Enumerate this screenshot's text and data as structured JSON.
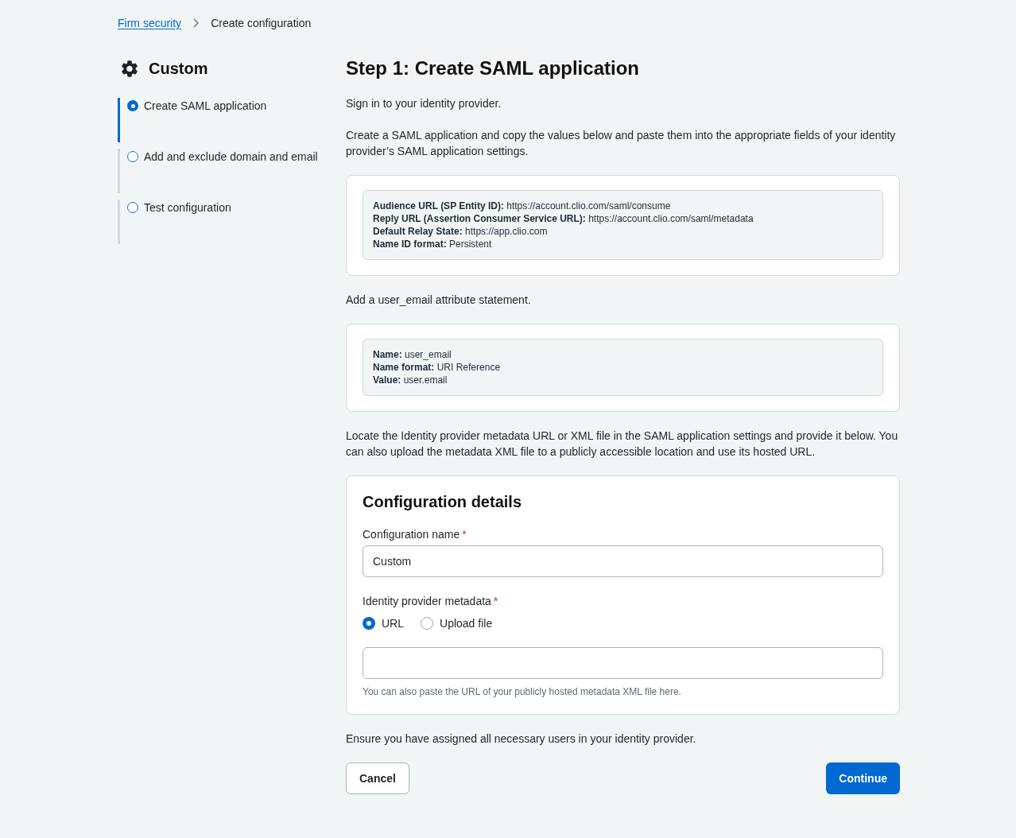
{
  "breadcrumb": [
    {
      "kind": "link",
      "label": "Firm security"
    },
    {
      "kind": "current",
      "label": "Create configuration"
    }
  ],
  "sidebar": {
    "title": "Custom",
    "steps": [
      {
        "label": "Create SAML application",
        "selected": true
      },
      {
        "label": "Add and exclude domain and email",
        "selected": false
      },
      {
        "label": "Test configuration",
        "selected": false
      }
    ]
  },
  "main": {
    "title": "Step 1: Create SAML application",
    "blocks": [
      {
        "kind": "paragraph",
        "text": "Sign in to your identity provider."
      },
      {
        "kind": "paragraph",
        "text": "Create a SAML application and copy the values below and paste them into the appropriate fields of your identity provider’s SAML application settings."
      },
      {
        "kind": "info_card",
        "lines": [
          "**Audience URL (SP Entity ID):** https://account.clio.com/saml/consume",
          "**Reply URL (Assertion Consumer Service URL):** https://account.clio.com/saml/metadata",
          "**Default Relay State:** https://app.clio.com",
          "**Name ID format:** Persistent"
        ]
      },
      {
        "kind": "paragraph",
        "text": "Add a user_email attribute statement."
      },
      {
        "kind": "info_card",
        "lines": [
          "**Name:** user_email",
          "**Name format:** URI Reference",
          "**Value:** user.email"
        ]
      },
      {
        "kind": "paragraph",
        "text": "Locate the Identity provider metadata URL or XML file in the SAML application settings and provide it below. You can also upload the metadata XML file to a publicly accessible location and use its hosted URL."
      },
      {
        "kind": "form_card",
        "title": "Configuration details",
        "fields": [
          {
            "kind": "text_input",
            "label": "Configuration name",
            "required_mark": "*",
            "value": "Custom"
          },
          {
            "kind": "radio_input",
            "label": "Identity provider metadata",
            "required_mark": "*",
            "options": [
              {
                "label": "URL",
                "selected": true
              },
              {
                "label": "Upload file",
                "selected": false
              }
            ],
            "hint": "You can also paste the URL of your publicly hosted metadata XML file here."
          }
        ]
      },
      {
        "kind": "paragraph",
        "text": "Ensure you have assigned all necessary users in your identity provider."
      }
    ],
    "buttons": [
      {
        "kind": "secondary",
        "label": "Cancel"
      },
      {
        "kind": "primary",
        "label": "Continue"
      }
    ]
  }
}
